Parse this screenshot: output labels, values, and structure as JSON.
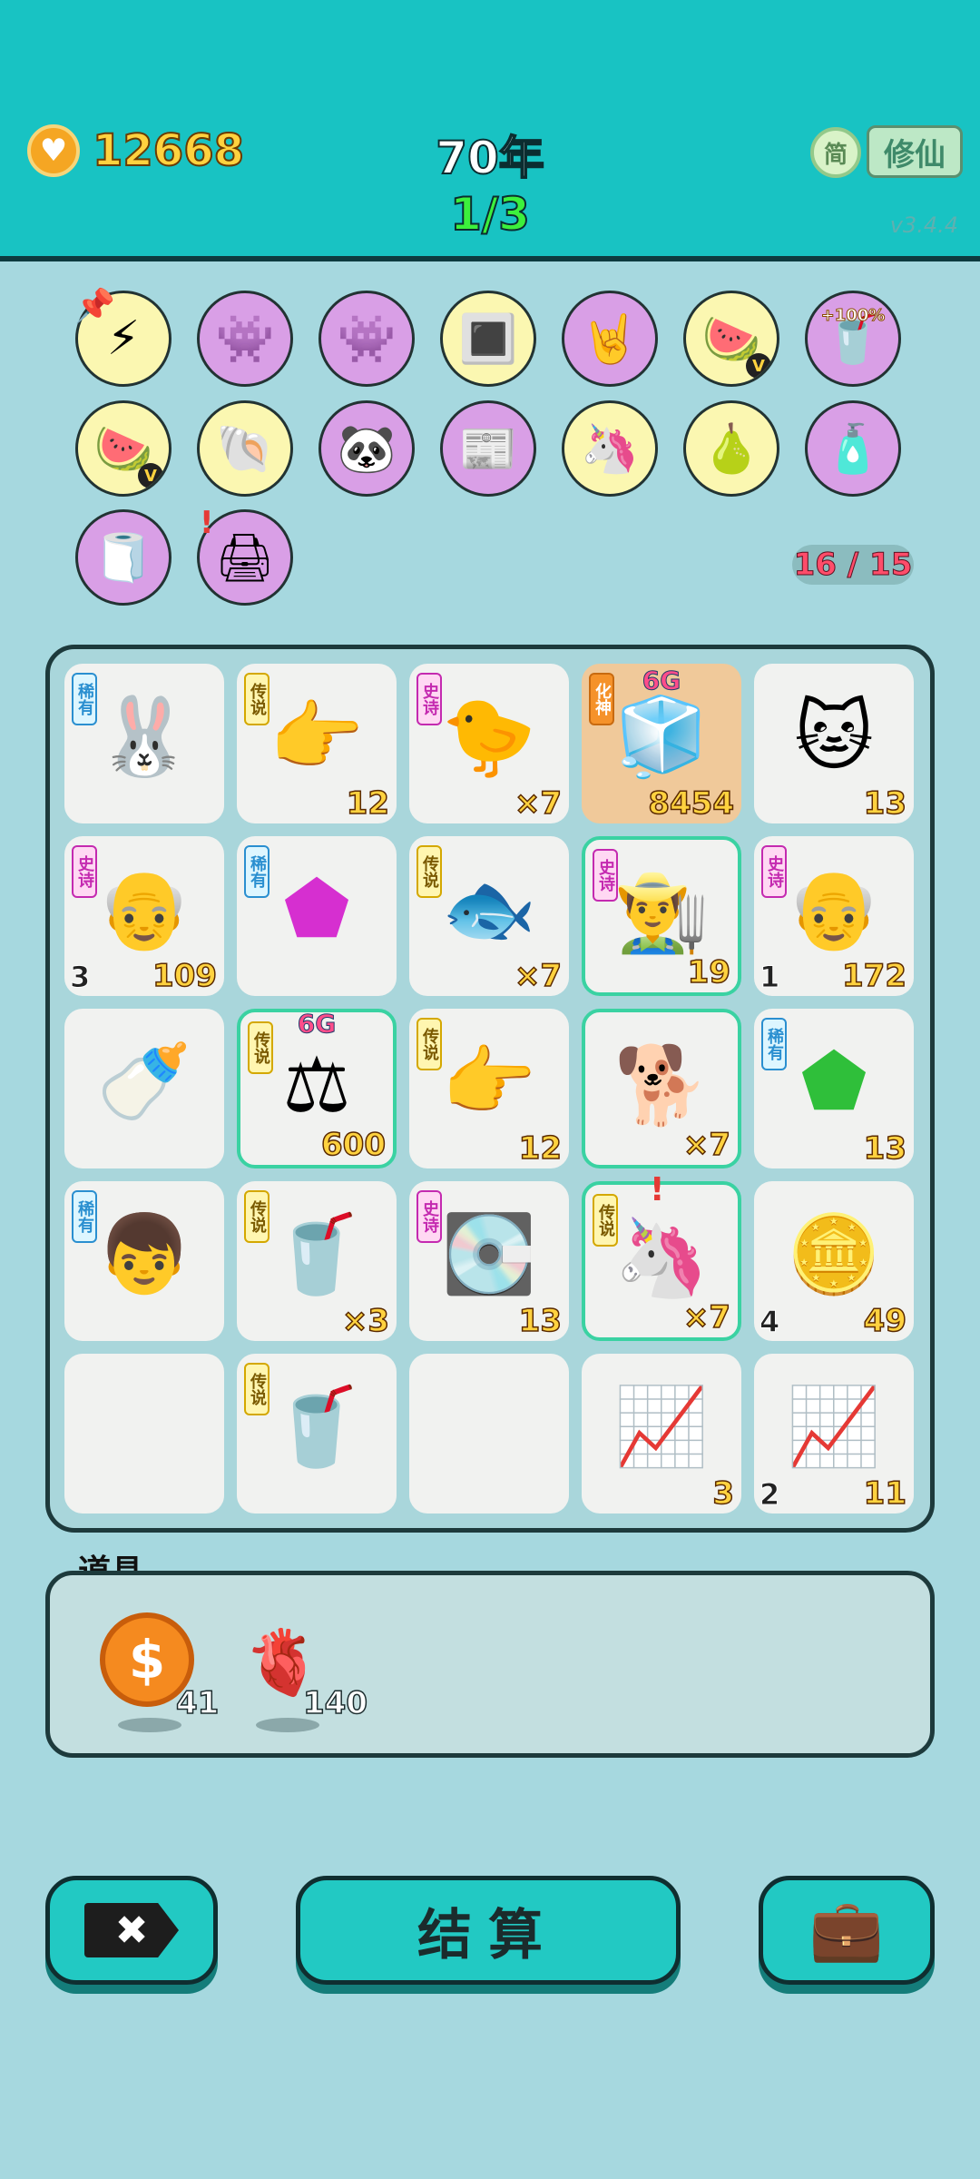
{
  "header": {
    "coins": "12668",
    "year": "70年",
    "round": "1/3",
    "lang": "简",
    "mode": "修仙",
    "version": "v3.4.4"
  },
  "relics": {
    "row1": [
      {
        "name": "lightning-relic-icon",
        "glyph": "⚡"
      },
      {
        "name": "robot-relic-icon",
        "glyph": "👾"
      },
      {
        "name": "robot-relic-icon",
        "glyph": "👾"
      },
      {
        "name": "cpu-chip-icon",
        "glyph": "🔳"
      },
      {
        "name": "rock-hand-icon",
        "glyph": "🤘"
      },
      {
        "name": "fruit-basket-icon",
        "glyph": "🍉",
        "sub": "V"
      },
      {
        "name": "milk-tea-icon",
        "glyph": "🥤",
        "pct": "+100%"
      }
    ],
    "row2": [
      {
        "name": "fruit-basket-icon",
        "glyph": "🍉",
        "sub": "V"
      },
      {
        "name": "shell-icon",
        "glyph": "🐚"
      },
      {
        "name": "panda-icon",
        "glyph": "🐼"
      },
      {
        "name": "time-magazine-icon",
        "glyph": "📰"
      },
      {
        "name": "unicorn-relic-icon",
        "glyph": "🦄"
      },
      {
        "name": "pomelo-icon",
        "glyph": "🍐"
      },
      {
        "name": "spray-bottle-icon",
        "glyph": "🧴"
      }
    ],
    "row3": [
      {
        "name": "tissue-box-icon",
        "glyph": "🧻"
      },
      {
        "name": "printer-icon",
        "glyph": "🖨"
      }
    ],
    "capacity": "16 / 15"
  },
  "board": {
    "rows": [
      [
        {
          "name": "rabbit-icon",
          "glyph": "🐰",
          "tag": "稀有",
          "tagc": "blue"
        },
        {
          "name": "pointing-hand-star-icon",
          "glyph": "👉",
          "tag": "传说",
          "tagc": "yellow",
          "count": "12"
        },
        {
          "name": "yellow-face-icon",
          "glyph": "🐤",
          "tag": "史诗",
          "tagc": "purple",
          "count": "×7"
        },
        {
          "name": "fridge-icon",
          "glyph": "🧊",
          "tag": "化神",
          "tagc": "orange",
          "tier": "6G",
          "count": "8454",
          "tan": true
        },
        {
          "name": "cat-icon",
          "glyph": "🐱",
          "count": "13"
        }
      ],
      [
        {
          "name": "grandpa-icon",
          "glyph": "👴",
          "tag": "史诗",
          "tagc": "purple",
          "level": "3",
          "count": "109"
        },
        {
          "name": "earth-element-icon",
          "glyph": "⬟",
          "tag": "稀有",
          "tagc": "blue"
        },
        {
          "name": "koi-fish-icon",
          "glyph": "🐟",
          "tag": "传说",
          "tagc": "yellow",
          "count": "×7"
        },
        {
          "name": "farmer-icon",
          "glyph": "👨‍🌾",
          "tag": "史诗",
          "tagc": "purple",
          "count": "19",
          "sel": true
        },
        {
          "name": "grandpa-icon",
          "glyph": "👴",
          "tag": "史诗",
          "tagc": "purple",
          "level": "1",
          "count": "172"
        }
      ],
      [
        {
          "name": "milk-bottle-icon",
          "glyph": "🍼"
        },
        {
          "name": "scale-icon",
          "glyph": "⚖",
          "tag": "传说",
          "tagc": "yellow",
          "tier": "6G",
          "count": "600",
          "sel": true
        },
        {
          "name": "pointing-hand-icon",
          "glyph": "👉",
          "tag": "传说",
          "tagc": "yellow",
          "count": "12"
        },
        {
          "name": "husky-dog-icon",
          "glyph": "🐕",
          "count": "×7",
          "sel": true
        },
        {
          "name": "wood-element-icon",
          "glyph": "⬟",
          "tag": "稀有",
          "tagc": "blue",
          "count": "13"
        }
      ],
      [
        {
          "name": "boy-face-icon",
          "glyph": "👦",
          "tag": "稀有",
          "tagc": "blue"
        },
        {
          "name": "milk-tea-moon-icon",
          "glyph": "🥤",
          "tag": "传说",
          "tagc": "yellow",
          "count": "×3"
        },
        {
          "name": "graphics-card-icon",
          "glyph": "💽",
          "tag": "史诗",
          "tagc": "purple",
          "count": "13"
        },
        {
          "name": "unicorn-icon",
          "glyph": "🦄",
          "tag": "传说",
          "tagc": "yellow",
          "count": "×7",
          "sel": true
        },
        {
          "name": "gold-bars-icon",
          "glyph": "🪙",
          "level": "4",
          "count": "49"
        }
      ],
      [
        {
          "name": "empty-slot",
          "glyph": ""
        },
        {
          "name": "milk-tea-icon",
          "glyph": "🥤",
          "tag": "传说",
          "tagc": "yellow"
        },
        {
          "name": "empty-slot",
          "glyph": ""
        },
        {
          "name": "growth-chart-icon",
          "glyph": "📈",
          "count": "3"
        },
        {
          "name": "trend-line-icon",
          "glyph": "📈",
          "level": "2",
          "count": "11"
        }
      ]
    ]
  },
  "items": {
    "label": "道具",
    "coin": {
      "symbol": "$",
      "count": "41"
    },
    "liver": {
      "glyph": "🫀",
      "count": "140"
    }
  },
  "buttons": {
    "close": "✖",
    "settle": "结算",
    "bag": "💼"
  },
  "colors": {
    "topbar": "#18c3c3",
    "background": "#a6d8df",
    "accent": "#22c9c3",
    "coin": "#ffd23f"
  }
}
